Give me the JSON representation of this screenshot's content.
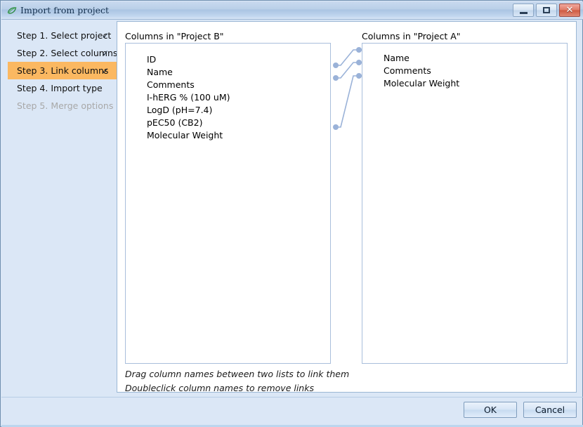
{
  "window": {
    "title": "Import from project",
    "icon": "leaf-icon",
    "controls": {
      "minimize": "–",
      "maximize": "□",
      "close": "✕"
    }
  },
  "sidebar": {
    "steps": [
      {
        "label": "Step 1. Select project",
        "check": "✓",
        "state": "done"
      },
      {
        "label": "Step 2. Select columns",
        "check": "✓",
        "state": "done"
      },
      {
        "label": "Step 3. Link columns",
        "check": "✓",
        "state": "active"
      },
      {
        "label": "Step 4. Import type",
        "check": "",
        "state": "normal"
      },
      {
        "label": "Step 5. Merge options",
        "check": "",
        "state": "disabled"
      }
    ]
  },
  "main": {
    "left_list": {
      "caption": "Columns in \"Project B\"",
      "items": [
        "ID",
        "Name",
        "Comments",
        "I-hERG % (100 uM)",
        "LogD (pH=7.4)",
        "pEC50 (CB2)",
        "Molecular Weight"
      ]
    },
    "right_list": {
      "caption": "Columns in \"Project A\"",
      "items": [
        "Name",
        "Comments",
        "Molecular Weight"
      ]
    },
    "links": [
      {
        "from": "Name",
        "to": "Name"
      },
      {
        "from": "Comments",
        "to": "Comments"
      },
      {
        "from": "Molecular Weight",
        "to": "Molecular Weight"
      }
    ],
    "hints": [
      "Drag column names between two lists to link them",
      "Doubleclick column names to remove links"
    ]
  },
  "footer": {
    "ok_label": "OK",
    "cancel_label": "Cancel"
  },
  "colors": {
    "accent_active_step": "#fbb861",
    "dialog_background": "#dbe7f6",
    "link_line": "#9ab2d8",
    "close_button": "#cf5941"
  }
}
